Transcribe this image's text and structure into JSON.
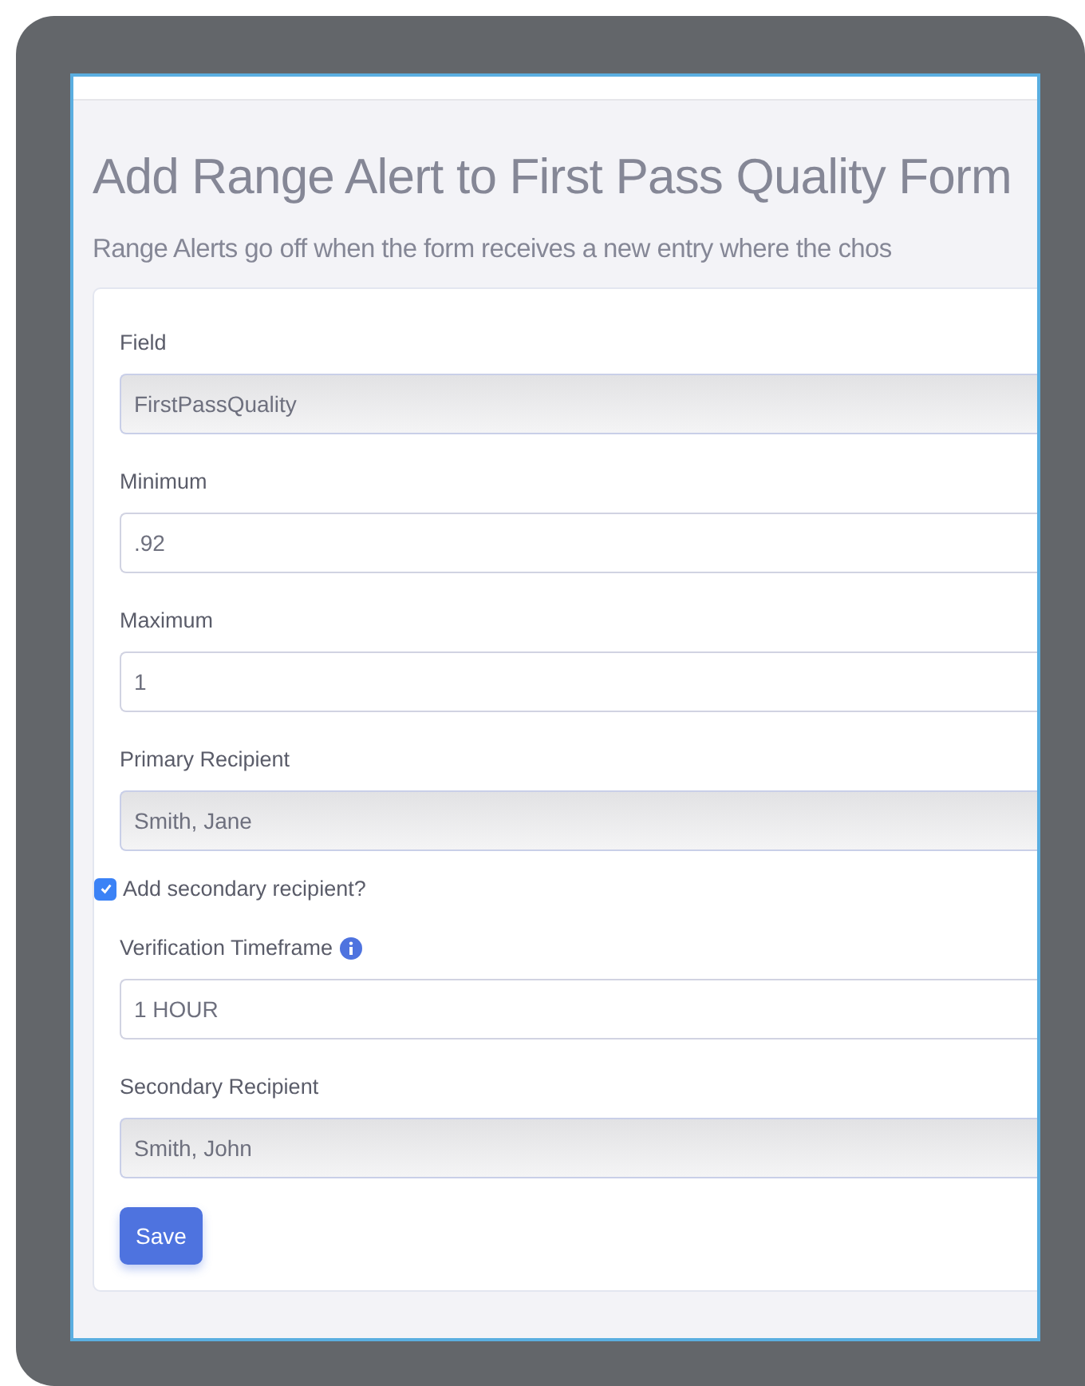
{
  "title": "Add Range Alert to First Pass Quality Form",
  "subtitle": "Range Alerts go off when the form receives a new entry where the chos",
  "form_items": [
    {
      "kind": "select",
      "label": "Field",
      "value": "FirstPassQuality"
    },
    {
      "kind": "input",
      "label": "Minimum",
      "value": ".92"
    },
    {
      "kind": "input",
      "label": "Maximum",
      "value": "1"
    },
    {
      "kind": "select",
      "label": "Primary Recipient",
      "value": "Smith, Jane"
    },
    {
      "kind": "checkbox",
      "label": "Add secondary recipient?",
      "checked": true
    },
    {
      "kind": "input",
      "label": "Verification Timeframe",
      "value": "1 HOUR",
      "info": true
    },
    {
      "kind": "select",
      "label": "Secondary Recipient",
      "value": "Smith, John"
    }
  ],
  "save_button": "Save"
}
